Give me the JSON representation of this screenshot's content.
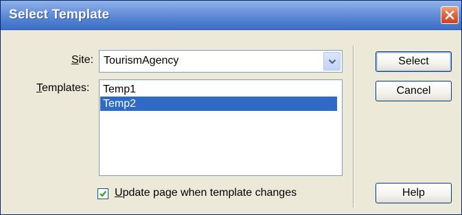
{
  "window": {
    "title": "Select Template"
  },
  "icons": {
    "close": "close-icon",
    "dropdown": "chevron-down-icon",
    "check": "checkmark-icon"
  },
  "colors": {
    "titlebar": "#4f7fd0",
    "close_button": "#e0683f",
    "selection": "#316ac5",
    "dialog_bg": "#ece9d8"
  },
  "form": {
    "site_label": "Site:",
    "site_label_access": "S",
    "site_label_rest": "ite:",
    "site_value": "TourismAgency",
    "templates_label_access": "T",
    "templates_label_rest": "emplates:",
    "templates": [
      {
        "label": "Temp1",
        "selected": false
      },
      {
        "label": "Temp2",
        "selected": true
      }
    ],
    "update_checkbox": {
      "checked": true,
      "label_access": "U",
      "label_rest": "pdate page when template changes"
    }
  },
  "buttons": {
    "select": "Select",
    "cancel": "Cancel",
    "help": "Help"
  }
}
